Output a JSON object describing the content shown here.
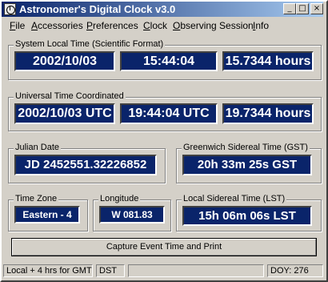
{
  "window": {
    "title": "Astronomer's Digital Clock v3.0",
    "controls": {
      "minimize": "_",
      "maximize": "□",
      "close": "×"
    }
  },
  "menu": [
    "File",
    "Accessories",
    "Preferences",
    "Clock",
    "Observing Session",
    "Info"
  ],
  "system_local_time": {
    "label": "System Local Time (Scientific Format)",
    "date": "2002/10/03",
    "time": "15:44:04",
    "hours": "15.7344 hours"
  },
  "utc": {
    "label": "Universal Time Coordinated",
    "date": "2002/10/03 UTC",
    "time": "19:44:04  UTC",
    "hours": "19.7344 hours"
  },
  "julian": {
    "label": "Julian Date",
    "value": "JD 2452551.32226852"
  },
  "gst": {
    "label": "Greenwich Sidereal Time (GST)",
    "value": "20h 33m 25s  GST"
  },
  "timezone": {
    "label": "Time Zone",
    "value": "Eastern - 4"
  },
  "longitude": {
    "label": "Longitude",
    "value": "W 081.83"
  },
  "lst": {
    "label": "Local Sidereal Time (LST)",
    "value": "15h 06m 06s  LST"
  },
  "capture_button": "Capture Event Time and Print",
  "status": {
    "offset": "Local + 4 hrs for GMT",
    "dst": "DST",
    "doy": "DOY: 276"
  }
}
